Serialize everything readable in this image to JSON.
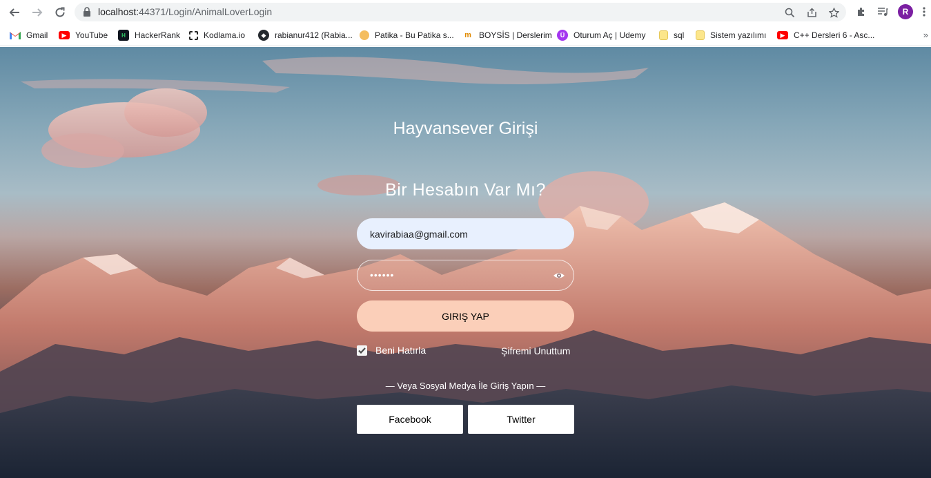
{
  "browser": {
    "url_host": "localhost:",
    "url_path": "44371/Login/AnimalLoverLogin",
    "profile_initial": "R",
    "bookmarks": [
      {
        "label": "Gmail",
        "icon": "gmail-icon"
      },
      {
        "label": "YouTube",
        "icon": "youtube-icon"
      },
      {
        "label": "HackerRank",
        "icon": "hackerrank-icon"
      },
      {
        "label": "Kodlama.io",
        "icon": "kodlama-icon"
      },
      {
        "label": "rabianur412 (Rabia...",
        "icon": "github-icon"
      },
      {
        "label": "Patika - Bu Patika s...",
        "icon": "patika-icon"
      },
      {
        "label": "BOYSİS | Derslerim",
        "icon": "boysis-icon"
      },
      {
        "label": "Oturum Aç | Udemy",
        "icon": "udemy-icon"
      },
      {
        "label": "sql",
        "icon": "folder-icon"
      },
      {
        "label": "Sistem yazılımı",
        "icon": "folder-icon"
      },
      {
        "label": "C++ Dersleri 6 - Asc...",
        "icon": "youtube-icon"
      }
    ],
    "more_bookmarks": "»"
  },
  "login": {
    "title": "Hayvansever Girişi",
    "subtitle": "Bir Hesabın Var Mı?",
    "email_value": "kavirabiaa@gmail.com",
    "password_mask": "••••••",
    "submit_label": "GIRIŞ YAP",
    "remember_label": "Beni Hatırla",
    "remember_checked": true,
    "forgot_label": "Şifremi Unuttum",
    "social_divider": "— Veya Sosyal Medya İle Giriş Yapın —",
    "facebook_label": "Facebook",
    "twitter_label": "Twitter"
  },
  "colors": {
    "submit_bg": "#fbcfb9",
    "email_bg": "#e8f0fe",
    "profile_bg": "#7b1fa2"
  }
}
